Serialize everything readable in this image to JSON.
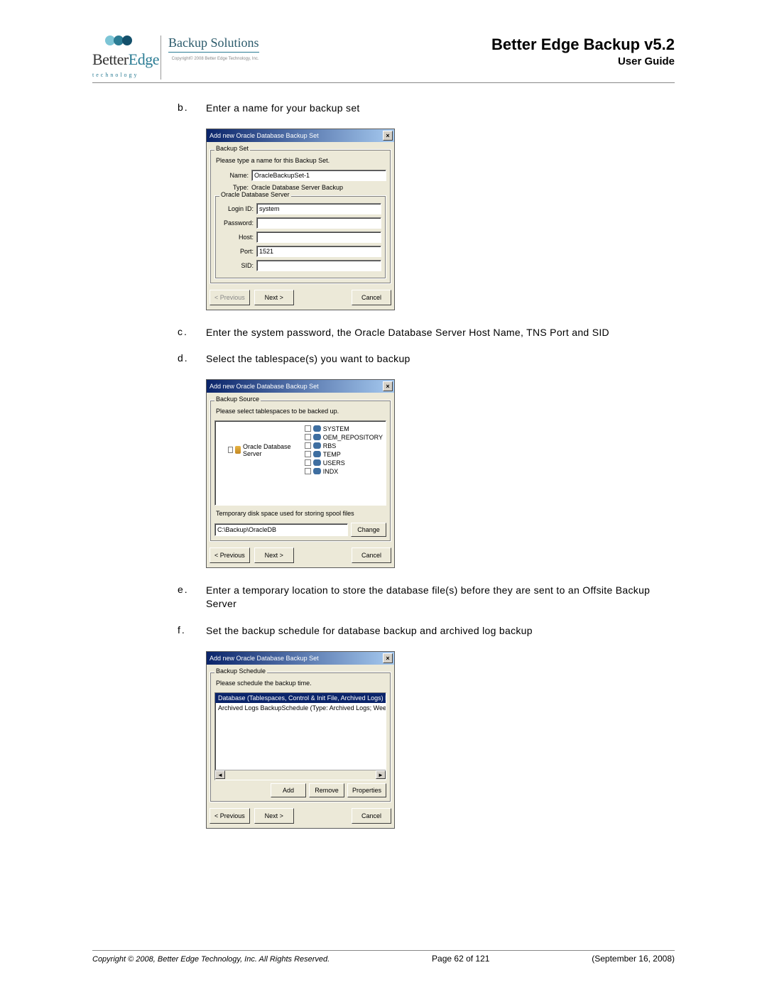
{
  "header": {
    "logo_primary_line1": "BetterEdge",
    "logo_primary_line2": "technology",
    "logo_secondary_title": "Backup Solutions",
    "logo_secondary_copy": "Copyright© 2008\nBetter Edge Technology, Inc.",
    "product": "Better Edge Backup v5.2",
    "guide": "User Guide"
  },
  "steps": {
    "b": {
      "marker": "b.",
      "text": "Enter a name for your backup set"
    },
    "c": {
      "marker": "c.",
      "text": "Enter the system password, the Oracle Database Server Host Name, TNS Port and SID"
    },
    "d": {
      "marker": "d.",
      "text": "Select the tablespace(s) you want to backup"
    },
    "e": {
      "marker": "e.",
      "text": "Enter a temporary location to store the database file(s) before they are sent to an Offsite Backup Server"
    },
    "f": {
      "marker": "f.",
      "text": "Set the backup schedule for database backup and archived log backup"
    }
  },
  "dialog1": {
    "title": "Add new Oracle Database Backup Set",
    "group1_legend": "Backup Set",
    "instruction": "Please type a name for this Backup Set.",
    "name_label": "Name:",
    "name_value": "OracleBackupSet-1",
    "type_label": "Type:",
    "type_value": "Oracle Database Server Backup",
    "subgroup_legend": "Oracle Database Server",
    "login_label": "Login ID:",
    "login_value": "system",
    "password_label": "Password:",
    "password_value": "",
    "host_label": "Host:",
    "host_value": "",
    "port_label": "Port:",
    "port_value": "1521",
    "sid_label": "SID:",
    "sid_value": "",
    "prev": "< Previous",
    "next": "Next >",
    "cancel": "Cancel"
  },
  "dialog2": {
    "title": "Add new Oracle Database Backup Set",
    "group_legend": "Backup Source",
    "instruction": "Please select tablespaces to be backed up.",
    "tree_root": "Oracle Database Server",
    "tree_items": [
      "SYSTEM",
      "OEM_REPOSITORY",
      "RBS",
      "TEMP",
      "USERS",
      "INDX"
    ],
    "spool_label": "Temporary disk space used for storing spool files",
    "spool_value": "C:\\Backup\\OracleDB",
    "change": "Change",
    "prev": "< Previous",
    "next": "Next >",
    "cancel": "Cancel"
  },
  "dialog3": {
    "title": "Add new Oracle Database Backup Set",
    "group_legend": "Backup Schedule",
    "instruction": "Please schedule the backup time.",
    "list_row1": "Database (Tablespaces, Control & Init File, Archived Logs) Backu",
    "list_row2": "Archived Logs BackupSchedule (Type: Archived Logs; Weekly - Mo",
    "add": "Add",
    "remove": "Remove",
    "properties": "Properties",
    "prev": "< Previous",
    "next": "Next >",
    "cancel": "Cancel"
  },
  "footer": {
    "copy": "Copyright © 2008, Better Edge Technology, Inc.   All Rights Reserved.",
    "page": "Page 62 of 121",
    "date": "(September 16, 2008)"
  }
}
